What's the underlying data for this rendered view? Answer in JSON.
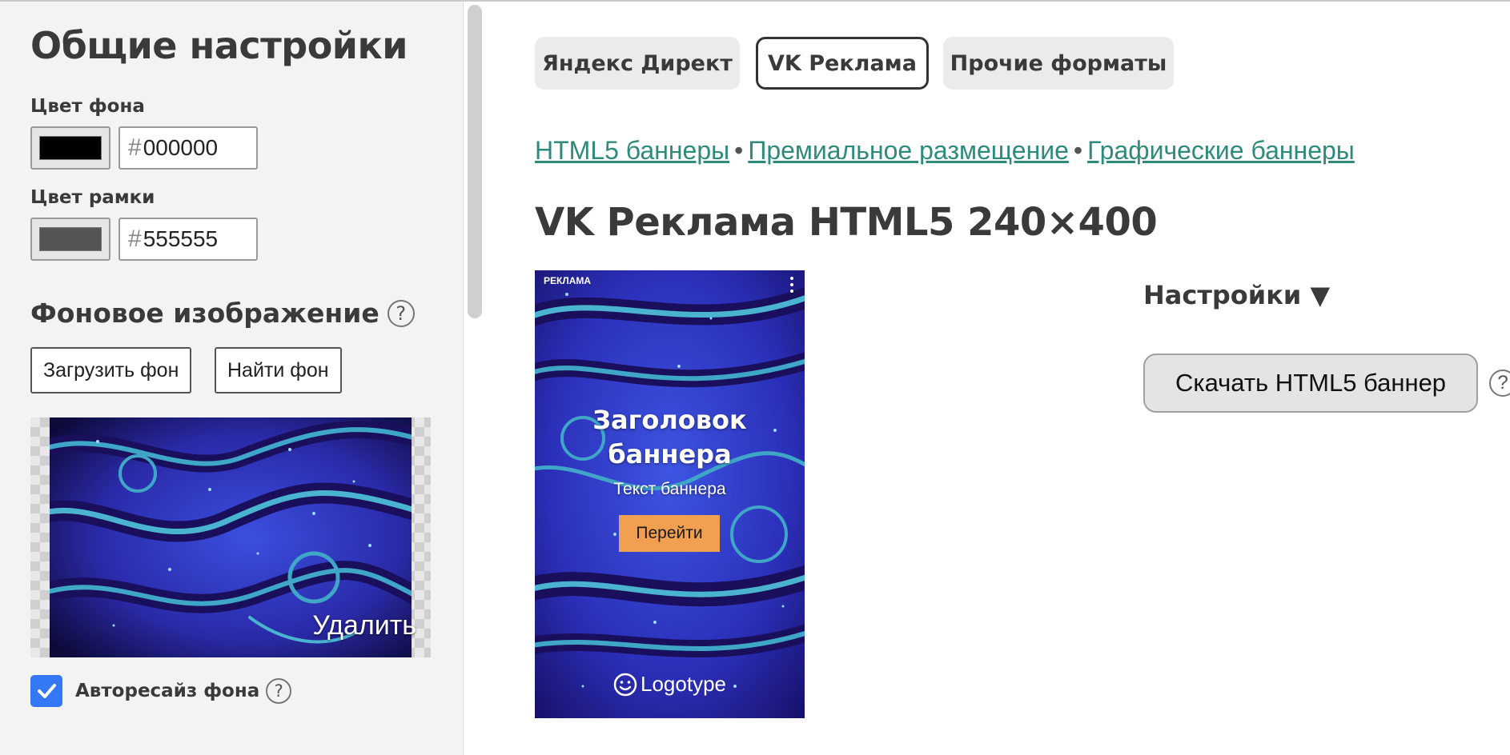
{
  "sidebar": {
    "title": "Общие настройки",
    "bg_color": {
      "label": "Цвет фона",
      "hash": "#",
      "value": "000000",
      "swatch": "#000000"
    },
    "border_color": {
      "label": "Цвет рамки",
      "hash": "#",
      "value": "555555",
      "swatch": "#555555"
    },
    "bg_image": {
      "title": "Фоновое изображение",
      "help": "?",
      "upload_label": "Загрузить фон",
      "find_label": "Найти фон",
      "delete_label": "Удалить"
    },
    "autoresize": {
      "label": "Авторесайз фона",
      "checked": true,
      "help": "?"
    }
  },
  "tabs": [
    {
      "label": "Яндекс Директ",
      "active": false
    },
    {
      "label": "VK Реклама",
      "active": true
    },
    {
      "label": "Прочие форматы",
      "active": false
    }
  ],
  "links": [
    "HTML5 баннеры",
    "Премиальное размещение",
    "Графические баннеры"
  ],
  "link_separator": "•",
  "page_title": "VK Реклама HTML5 240×400",
  "banner": {
    "ad_label": "РЕКЛАМА",
    "headline": "Заголовок баннера",
    "text": "Текст баннера",
    "button": "Перейти",
    "logo": "Logotype"
  },
  "settings_label": "Настройки ▼",
  "download_label": "Скачать HTML5 баннер",
  "download_help": "?",
  "colors": {
    "accent_link": "#2e8b7b",
    "checkbox": "#3478f6",
    "banner_button": "#f0a050",
    "banner_bg": "#2b2fb8"
  }
}
